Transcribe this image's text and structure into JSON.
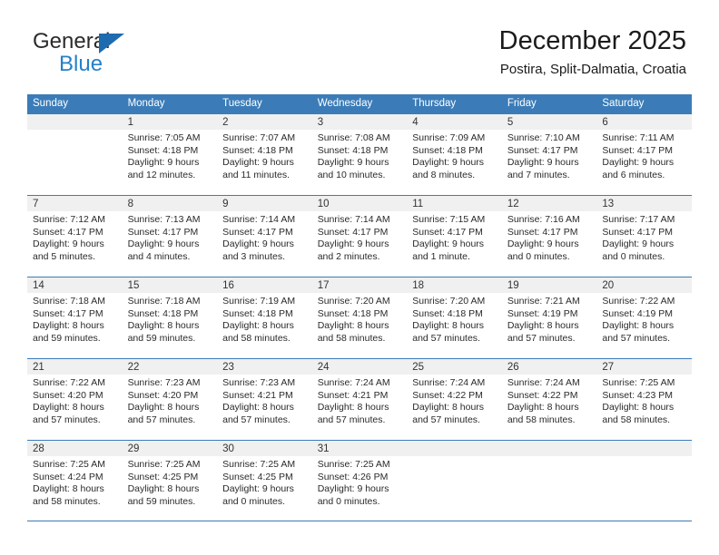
{
  "brand": {
    "name_dark": "General",
    "name_blue": "Blue",
    "triangle_color": "#1f6bb0",
    "blue_color": "#2481c8"
  },
  "header": {
    "title": "December 2025",
    "subtitle": "Postira, Split-Dalmatia, Croatia"
  },
  "theme": {
    "header_bg": "#3b7cb8",
    "daynum_bg": "#f0f0f0",
    "grid_line": "#3b7cb8"
  },
  "weekdays": [
    "Sunday",
    "Monday",
    "Tuesday",
    "Wednesday",
    "Thursday",
    "Friday",
    "Saturday"
  ],
  "labels": {
    "sunrise_prefix": "Sunrise:",
    "sunset_prefix": "Sunset:",
    "daylight_prefix": "Daylight:"
  },
  "weeks": [
    [
      {
        "day": "",
        "l1": "",
        "l2": "",
        "l3": "",
        "l4": ""
      },
      {
        "day": "1",
        "l1": "Sunrise: 7:05 AM",
        "l2": "Sunset: 4:18 PM",
        "l3": "Daylight: 9 hours",
        "l4": "and 12 minutes."
      },
      {
        "day": "2",
        "l1": "Sunrise: 7:07 AM",
        "l2": "Sunset: 4:18 PM",
        "l3": "Daylight: 9 hours",
        "l4": "and 11 minutes."
      },
      {
        "day": "3",
        "l1": "Sunrise: 7:08 AM",
        "l2": "Sunset: 4:18 PM",
        "l3": "Daylight: 9 hours",
        "l4": "and 10 minutes."
      },
      {
        "day": "4",
        "l1": "Sunrise: 7:09 AM",
        "l2": "Sunset: 4:18 PM",
        "l3": "Daylight: 9 hours",
        "l4": "and 8 minutes."
      },
      {
        "day": "5",
        "l1": "Sunrise: 7:10 AM",
        "l2": "Sunset: 4:17 PM",
        "l3": "Daylight: 9 hours",
        "l4": "and 7 minutes."
      },
      {
        "day": "6",
        "l1": "Sunrise: 7:11 AM",
        "l2": "Sunset: 4:17 PM",
        "l3": "Daylight: 9 hours",
        "l4": "and 6 minutes."
      }
    ],
    [
      {
        "day": "7",
        "l1": "Sunrise: 7:12 AM",
        "l2": "Sunset: 4:17 PM",
        "l3": "Daylight: 9 hours",
        "l4": "and 5 minutes."
      },
      {
        "day": "8",
        "l1": "Sunrise: 7:13 AM",
        "l2": "Sunset: 4:17 PM",
        "l3": "Daylight: 9 hours",
        "l4": "and 4 minutes."
      },
      {
        "day": "9",
        "l1": "Sunrise: 7:14 AM",
        "l2": "Sunset: 4:17 PM",
        "l3": "Daylight: 9 hours",
        "l4": "and 3 minutes."
      },
      {
        "day": "10",
        "l1": "Sunrise: 7:14 AM",
        "l2": "Sunset: 4:17 PM",
        "l3": "Daylight: 9 hours",
        "l4": "and 2 minutes."
      },
      {
        "day": "11",
        "l1": "Sunrise: 7:15 AM",
        "l2": "Sunset: 4:17 PM",
        "l3": "Daylight: 9 hours",
        "l4": "and 1 minute."
      },
      {
        "day": "12",
        "l1": "Sunrise: 7:16 AM",
        "l2": "Sunset: 4:17 PM",
        "l3": "Daylight: 9 hours",
        "l4": "and 0 minutes."
      },
      {
        "day": "13",
        "l1": "Sunrise: 7:17 AM",
        "l2": "Sunset: 4:17 PM",
        "l3": "Daylight: 9 hours",
        "l4": "and 0 minutes."
      }
    ],
    [
      {
        "day": "14",
        "l1": "Sunrise: 7:18 AM",
        "l2": "Sunset: 4:17 PM",
        "l3": "Daylight: 8 hours",
        "l4": "and 59 minutes."
      },
      {
        "day": "15",
        "l1": "Sunrise: 7:18 AM",
        "l2": "Sunset: 4:18 PM",
        "l3": "Daylight: 8 hours",
        "l4": "and 59 minutes."
      },
      {
        "day": "16",
        "l1": "Sunrise: 7:19 AM",
        "l2": "Sunset: 4:18 PM",
        "l3": "Daylight: 8 hours",
        "l4": "and 58 minutes."
      },
      {
        "day": "17",
        "l1": "Sunrise: 7:20 AM",
        "l2": "Sunset: 4:18 PM",
        "l3": "Daylight: 8 hours",
        "l4": "and 58 minutes."
      },
      {
        "day": "18",
        "l1": "Sunrise: 7:20 AM",
        "l2": "Sunset: 4:18 PM",
        "l3": "Daylight: 8 hours",
        "l4": "and 57 minutes."
      },
      {
        "day": "19",
        "l1": "Sunrise: 7:21 AM",
        "l2": "Sunset: 4:19 PM",
        "l3": "Daylight: 8 hours",
        "l4": "and 57 minutes."
      },
      {
        "day": "20",
        "l1": "Sunrise: 7:22 AM",
        "l2": "Sunset: 4:19 PM",
        "l3": "Daylight: 8 hours",
        "l4": "and 57 minutes."
      }
    ],
    [
      {
        "day": "21",
        "l1": "Sunrise: 7:22 AM",
        "l2": "Sunset: 4:20 PM",
        "l3": "Daylight: 8 hours",
        "l4": "and 57 minutes."
      },
      {
        "day": "22",
        "l1": "Sunrise: 7:23 AM",
        "l2": "Sunset: 4:20 PM",
        "l3": "Daylight: 8 hours",
        "l4": "and 57 minutes."
      },
      {
        "day": "23",
        "l1": "Sunrise: 7:23 AM",
        "l2": "Sunset: 4:21 PM",
        "l3": "Daylight: 8 hours",
        "l4": "and 57 minutes."
      },
      {
        "day": "24",
        "l1": "Sunrise: 7:24 AM",
        "l2": "Sunset: 4:21 PM",
        "l3": "Daylight: 8 hours",
        "l4": "and 57 minutes."
      },
      {
        "day": "25",
        "l1": "Sunrise: 7:24 AM",
        "l2": "Sunset: 4:22 PM",
        "l3": "Daylight: 8 hours",
        "l4": "and 57 minutes."
      },
      {
        "day": "26",
        "l1": "Sunrise: 7:24 AM",
        "l2": "Sunset: 4:22 PM",
        "l3": "Daylight: 8 hours",
        "l4": "and 58 minutes."
      },
      {
        "day": "27",
        "l1": "Sunrise: 7:25 AM",
        "l2": "Sunset: 4:23 PM",
        "l3": "Daylight: 8 hours",
        "l4": "and 58 minutes."
      }
    ],
    [
      {
        "day": "28",
        "l1": "Sunrise: 7:25 AM",
        "l2": "Sunset: 4:24 PM",
        "l3": "Daylight: 8 hours",
        "l4": "and 58 minutes."
      },
      {
        "day": "29",
        "l1": "Sunrise: 7:25 AM",
        "l2": "Sunset: 4:25 PM",
        "l3": "Daylight: 8 hours",
        "l4": "and 59 minutes."
      },
      {
        "day": "30",
        "l1": "Sunrise: 7:25 AM",
        "l2": "Sunset: 4:25 PM",
        "l3": "Daylight: 9 hours",
        "l4": "and 0 minutes."
      },
      {
        "day": "31",
        "l1": "Sunrise: 7:25 AM",
        "l2": "Sunset: 4:26 PM",
        "l3": "Daylight: 9 hours",
        "l4": "and 0 minutes."
      },
      {
        "day": "",
        "l1": "",
        "l2": "",
        "l3": "",
        "l4": ""
      },
      {
        "day": "",
        "l1": "",
        "l2": "",
        "l3": "",
        "l4": ""
      },
      {
        "day": "",
        "l1": "",
        "l2": "",
        "l3": "",
        "l4": ""
      }
    ]
  ]
}
